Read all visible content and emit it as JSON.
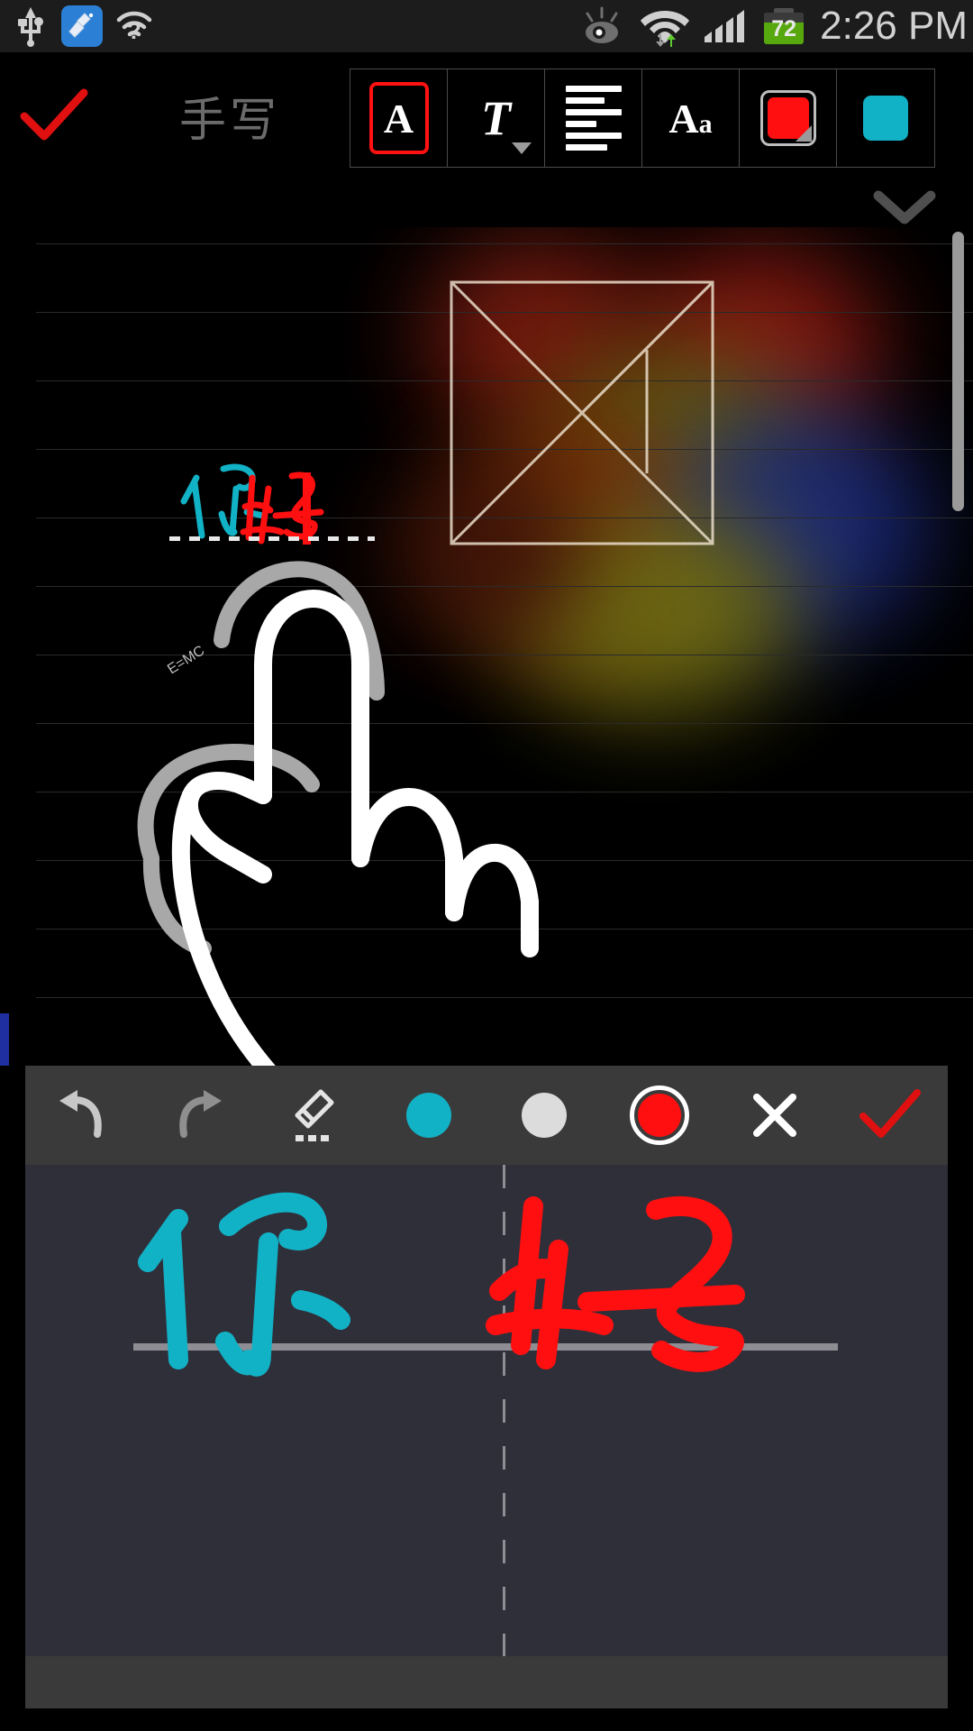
{
  "statusbar": {
    "icons": [
      "usb-icon",
      "cleaner-app-icon",
      "wifi-question-icon",
      "smart-stay-eye-icon",
      "wifi-signal-icon",
      "cellular-signal-icon"
    ],
    "battery_level": "72",
    "time": "2:26 PM"
  },
  "topbar": {
    "confirm_label": "✓",
    "title": "手写",
    "tools": [
      {
        "name": "text-style-button",
        "label": "A",
        "selected": true
      },
      {
        "name": "text-format-button",
        "label": "T",
        "selected": false
      },
      {
        "name": "text-align-button",
        "label": "",
        "selected": false
      },
      {
        "name": "font-size-button",
        "label": "Aa",
        "selected": false
      },
      {
        "name": "text-color-button",
        "label": "",
        "color": "#ff0f0f",
        "selected": true
      },
      {
        "name": "highlight-color-button",
        "label": "",
        "color": "#12b2c6",
        "selected": false
      }
    ],
    "collapse_icon": "chevron-down-icon"
  },
  "canvas": {
    "inserted_text": "你好",
    "inserted_text_colors": [
      "#12b2c6",
      "#ff0f0f"
    ],
    "tiny_annotation": "E=MC",
    "shape_name": "tangram-square-sketch",
    "drawing_name": "hand-pointing-sketch",
    "scrollbar_name": "vertical-scrollbar",
    "bookmark_name": "page-marker"
  },
  "toolbar": {
    "items": [
      {
        "name": "undo-button",
        "icon": "undo-icon",
        "label": ""
      },
      {
        "name": "redo-button",
        "icon": "redo-icon",
        "label": ""
      },
      {
        "name": "eraser-button",
        "icon": "eraser-icon",
        "label": ""
      },
      {
        "name": "pen-color-cyan",
        "icon": "color-dot-icon",
        "color": "#12b2c6",
        "selected": false
      },
      {
        "name": "pen-color-white",
        "icon": "color-dot-icon",
        "color": "#dcdcdc",
        "selected": false
      },
      {
        "name": "pen-color-red",
        "icon": "color-dot-icon",
        "color": "#ff0f0f",
        "selected": true
      },
      {
        "name": "cancel-button",
        "icon": "close-icon",
        "label": "✕"
      },
      {
        "name": "done-button",
        "icon": "check-icon",
        "label": "✓"
      }
    ]
  },
  "handwriting_pad": {
    "character_left": "你",
    "character_left_color": "#12b2c6",
    "character_right": "好",
    "character_right_color": "#ff0f0f",
    "background": "#2f2f3a"
  }
}
